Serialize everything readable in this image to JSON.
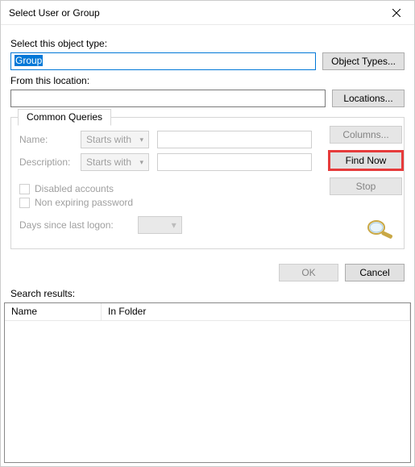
{
  "window": {
    "title": "Select User or Group"
  },
  "objectType": {
    "label": "Select this object type:",
    "value": "Group",
    "button": "Object Types..."
  },
  "location": {
    "label": "From this location:",
    "value": "",
    "button": "Locations..."
  },
  "tab": {
    "label": "Common Queries"
  },
  "queries": {
    "name_label": "Name:",
    "name_mode": "Starts with",
    "desc_label": "Description:",
    "desc_mode": "Starts with",
    "disabled_label": "Disabled accounts",
    "nonexp_label": "Non expiring password",
    "days_label": "Days since last logon:"
  },
  "buttons": {
    "columns": "Columns...",
    "find_now": "Find Now",
    "stop": "Stop",
    "ok": "OK",
    "cancel": "Cancel"
  },
  "results": {
    "label": "Search results:",
    "col_name": "Name",
    "col_folder": "In Folder"
  }
}
